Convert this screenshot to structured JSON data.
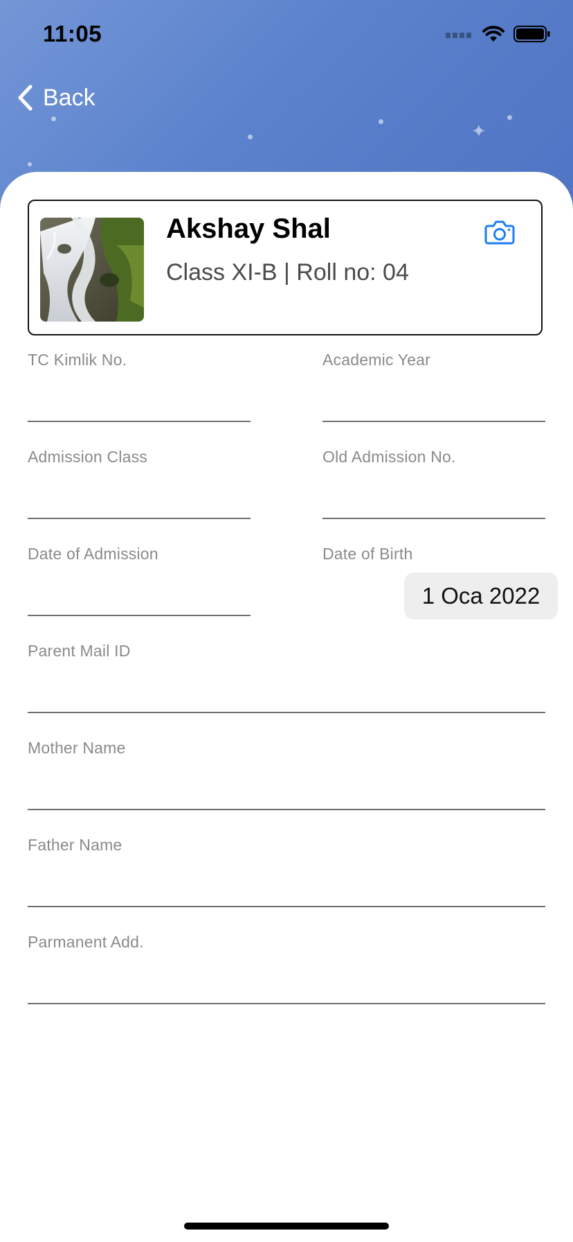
{
  "status_bar": {
    "time": "11:05"
  },
  "nav": {
    "back_label": "Back"
  },
  "profile": {
    "name": "Akshay Shal",
    "details": "Class XI-B | Roll no: 04"
  },
  "fields": {
    "tc_kimlik": {
      "label": "TC Kimlik No.",
      "value": ""
    },
    "academic_year": {
      "label": "Academic Year",
      "value": ""
    },
    "admission_class": {
      "label": "Admission Class",
      "value": ""
    },
    "old_admission_no": {
      "label": "Old Admission No.",
      "value": ""
    },
    "date_of_admission": {
      "label": "Date of Admission",
      "value": ""
    },
    "date_of_birth": {
      "label": "Date of Birth",
      "value": "1 Oca 2022"
    },
    "parent_mail": {
      "label": "Parent Mail ID",
      "value": ""
    },
    "mother_name": {
      "label": "Mother Name",
      "value": ""
    },
    "father_name": {
      "label": "Father Name",
      "value": ""
    },
    "permanent_address": {
      "label": "Parmanent Add.",
      "value": ""
    }
  },
  "colors": {
    "accent": "#1a7ef2",
    "header": "#5b82cc"
  }
}
